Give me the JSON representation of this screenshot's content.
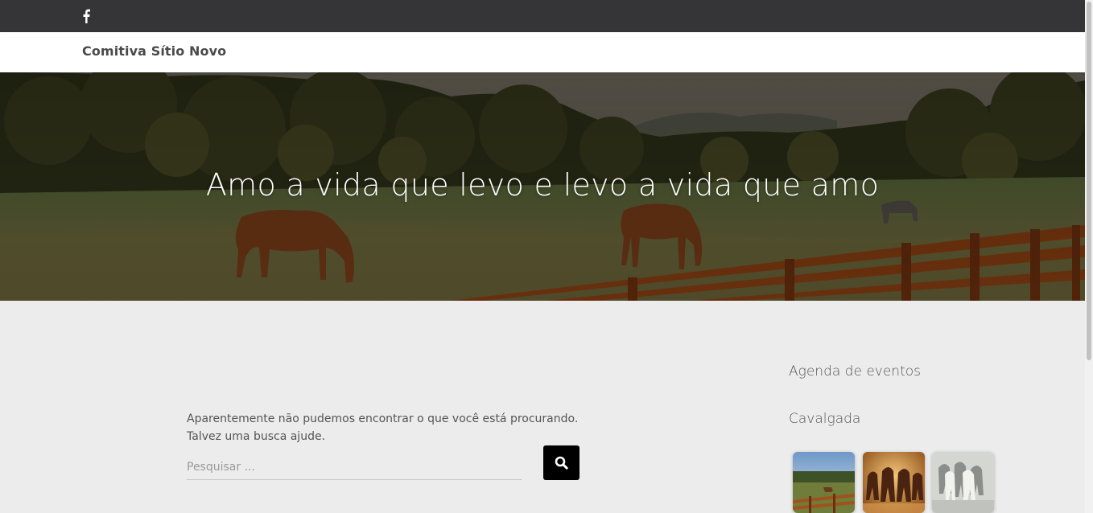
{
  "topbar": {
    "social_icon": "facebook-icon",
    "background": "#353538"
  },
  "navbar": {
    "site_title": "Comitiva Sítio Novo"
  },
  "hero": {
    "tagline": "Amo a vida que levo e levo a vida que amo"
  },
  "content": {
    "notfound_line1": "Aparentemente não pudemos encontrar o que você está procurando.",
    "notfound_line2": "Talvez uma busca ajude.",
    "search_placeholder": "Pesquisar ...",
    "search_button_icon": "search-icon"
  },
  "sidebar": {
    "widget_events_title": "Agenda de eventos",
    "widget_gallery_title": "Cavalgada",
    "gallery": [
      {
        "icon": "pasture-photo"
      },
      {
        "icon": "running-horses-photo"
      },
      {
        "icon": "white-horses-photo"
      }
    ]
  }
}
